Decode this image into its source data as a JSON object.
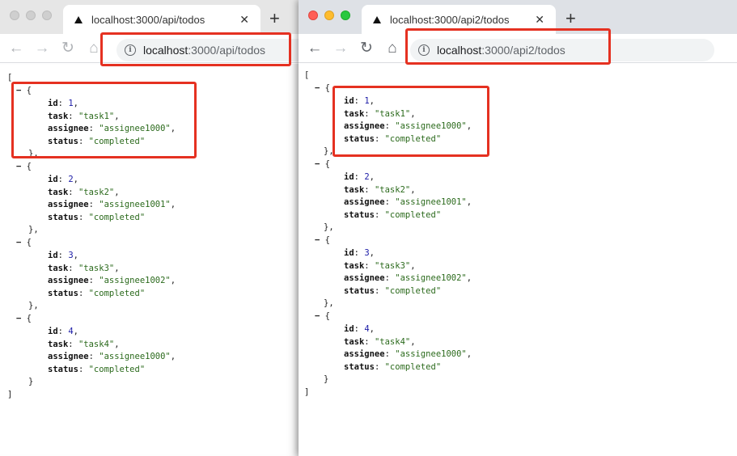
{
  "left": {
    "tab_title": "localhost:3000/api/todos",
    "url_host": "localhost",
    "url_path": ":3000/api/todos",
    "todos": [
      {
        "id": 1,
        "task": "task1",
        "assignee": "assignee1000",
        "status": "completed"
      },
      {
        "id": 2,
        "task": "task2",
        "assignee": "assignee1001",
        "status": "completed"
      },
      {
        "id": 3,
        "task": "task3",
        "assignee": "assignee1002",
        "status": "completed"
      },
      {
        "id": 4,
        "task": "task4",
        "assignee": "assignee1000",
        "status": "completed"
      }
    ]
  },
  "right": {
    "tab_title": "localhost:3000/api2/todos",
    "url_host": "localhost",
    "url_path": ":3000/api2/todos",
    "todos": [
      {
        "id": 1,
        "task": "task1",
        "assignee": "assignee1000",
        "status": "completed"
      },
      {
        "id": 2,
        "task": "task2",
        "assignee": "assignee1001",
        "status": "completed"
      },
      {
        "id": 3,
        "task": "task3",
        "assignee": "assignee1002",
        "status": "completed"
      },
      {
        "id": 4,
        "task": "task4",
        "assignee": "assignee1000",
        "status": "completed"
      }
    ]
  },
  "common": {
    "new_tab_glyph": "+",
    "close_glyph": "✕",
    "back_glyph": "←",
    "forward_glyph": "→",
    "reload_glyph": "↻",
    "home_glyph": "⌂",
    "info_glyph": "i",
    "open_bracket": "[",
    "close_bracket": "]",
    "object_open": "{",
    "object_close": "}",
    "collapse_glyph": "−",
    "keys": {
      "id": "id",
      "task": "task",
      "assignee": "assignee",
      "status": "status"
    }
  }
}
